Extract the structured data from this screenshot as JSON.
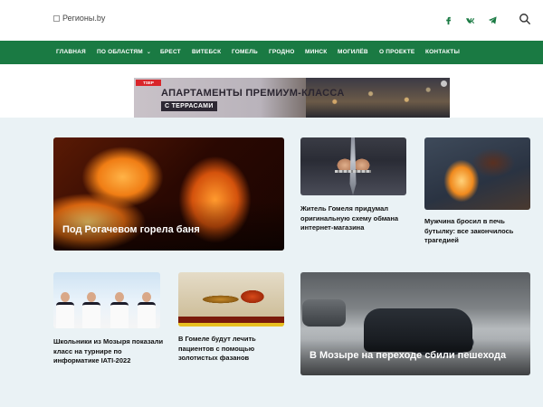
{
  "header": {
    "logo_alt": "Регионы.by",
    "social": [
      {
        "name": "facebook-icon"
      },
      {
        "name": "vk-icon"
      },
      {
        "name": "telegram-icon"
      }
    ]
  },
  "nav": {
    "items": [
      {
        "label": "ГЛАВНАЯ"
      },
      {
        "label": "ПО ОБЛАСТЯМ",
        "dropdown": "⌄"
      },
      {
        "label": "БРЕСТ"
      },
      {
        "label": "ВИТЕБСК"
      },
      {
        "label": "ГОМЕЛЬ"
      },
      {
        "label": "ГРОДНО"
      },
      {
        "label": "МИНСК"
      },
      {
        "label": "МОГИЛЁВ"
      },
      {
        "label": "О ПРОЕКТЕ"
      },
      {
        "label": "КОНТАКТЫ"
      }
    ],
    "color": "#1a7a43"
  },
  "banner": {
    "brand": "TSEP",
    "title": "АПАРТАМЕНТЫ ПРЕМИУМ-КЛАССА",
    "subtitle": "С ТЕРРАСАМИ"
  },
  "articles": [
    {
      "title": "Под Рогачевом горела баня"
    },
    {
      "title": "Житель Гомеля придумал оригинальную схему обмана интернет-магазина"
    },
    {
      "title": "Мужчина бросил в печь бутылку: все закончилось трагедией"
    },
    {
      "title": "Школьники из Мозыря показали класс на турнире по информатике IATI-2022"
    },
    {
      "title": "В Гомеле будут лечить пациентов с помощью золотистых фазанов"
    },
    {
      "title": "В Мозыре на переходе сбили пешехода"
    }
  ]
}
